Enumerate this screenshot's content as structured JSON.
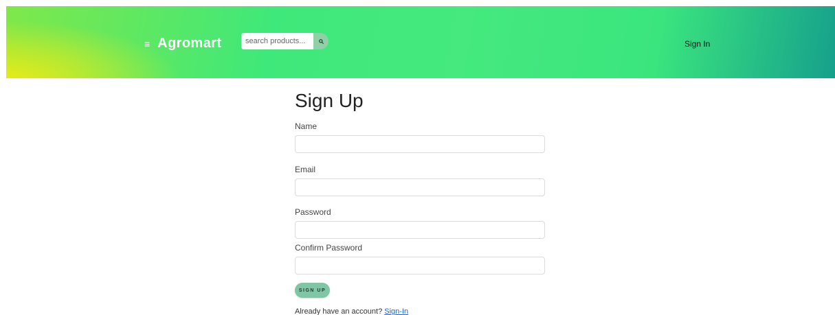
{
  "header": {
    "menu_icon": "hamburger-menu-icon",
    "brand": "Agromart",
    "search_placeholder": "search products...",
    "search_icon": "search-icon",
    "sign_in": "Sign In"
  },
  "form": {
    "title": "Sign Up",
    "fields": [
      {
        "label": "Name",
        "value": ""
      },
      {
        "label": "Email",
        "value": ""
      },
      {
        "label": "Password",
        "value": ""
      },
      {
        "label": "Confirm Password",
        "value": ""
      }
    ],
    "submit_label": "SIGN UP",
    "footer_text": "Already have an account?",
    "footer_link": "Sign-In"
  },
  "colors": {
    "header_gradient_start": "#e6ea1a",
    "header_gradient_mid": "#3fe87a",
    "header_gradient_end": "#16a08c",
    "button": "#7fc6a4",
    "link": "#1a66cc"
  }
}
